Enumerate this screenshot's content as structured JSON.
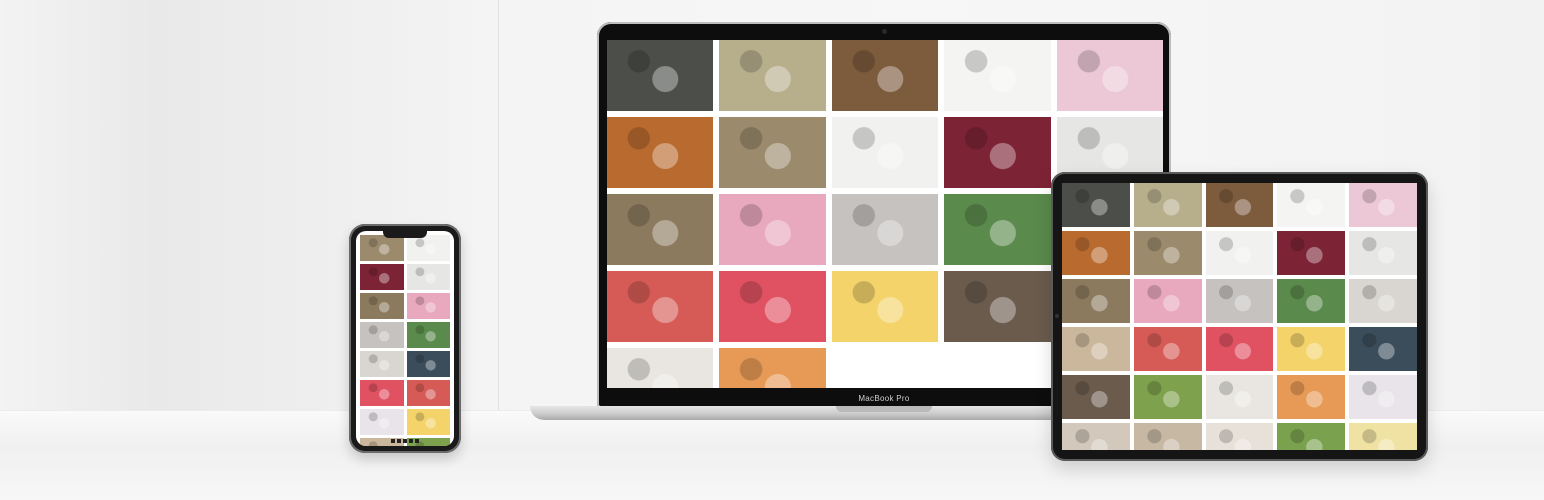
{
  "laptop": {
    "brand_label": "MacBook Pro",
    "tile_colors": [
      "#4b4e49",
      "#b7ae8c",
      "#7d5b3d",
      "#f4f4f2",
      "#ecc8d6",
      "#b86a2f",
      "#9c8a6c",
      "#f1f1ef",
      "#7d2336",
      "#e6e6e4",
      "#8c7a5e",
      "#e8a8bd",
      "#c5c2bf",
      "#5a8a4c",
      "#cbb79c",
      "#d65b56",
      "#e05262",
      "#f3d36a",
      "#6a5b4d",
      "#7da14c",
      "#e9e6e1",
      "#e79a56"
    ]
  },
  "tablet": {
    "tile_colors": [
      "#4b4e49",
      "#b7ae8c",
      "#7d5b3d",
      "#f4f4f2",
      "#ecc8d6",
      "#b86a2f",
      "#9c8a6c",
      "#f1f1ef",
      "#7d2336",
      "#e6e6e4",
      "#8c7a5e",
      "#e8a8bd",
      "#c5c2bf",
      "#5a8a4c",
      "#d9d6d1",
      "#cbb79c",
      "#d65b56",
      "#e05262",
      "#f3d36a",
      "#3b4d5a",
      "#6a5b4d",
      "#7da14c",
      "#e9e6e1",
      "#e79a56",
      "#e8e4ea",
      "#d2c8bb",
      "#c7b8a4",
      "#e8e1da",
      "#7aa14d",
      "#f0e2a3"
    ]
  },
  "phone": {
    "tile_colors": [
      "#9c8a6c",
      "#f1f1ef",
      "#7d2336",
      "#e6e6e4",
      "#8c7a5e",
      "#e8a8bd",
      "#c5c2bf",
      "#5a8a4c",
      "#d9d6d1",
      "#3b4d5a",
      "#e05262",
      "#d65b56",
      "#e8e4ea",
      "#f3d36a",
      "#cbb79c",
      "#7da14c"
    ]
  }
}
